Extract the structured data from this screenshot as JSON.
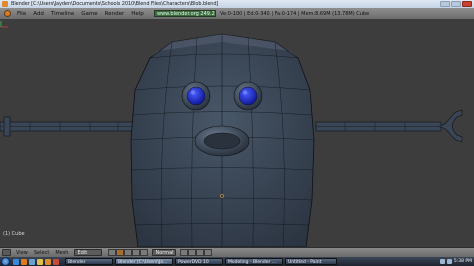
{
  "window": {
    "title": "Blender [C:\\Users\\Jayden\\Documents\\Schools 2010\\Blend Files\\Characters\\Blob.blend]",
    "buttons": [
      "minimize",
      "maximize",
      "close"
    ]
  },
  "menubar": {
    "items": [
      "File",
      "Add",
      "Timeline",
      "Game",
      "Render",
      "Help"
    ],
    "url": "www.blender.org 249.2",
    "stats": "Ve:0-100 | Ed:0-340 | Fa:0-174 | Mem:8.69M (13.78M) Cube"
  },
  "viewport": {
    "object_label": "(1) Cube",
    "background": "#3d3d3d",
    "mesh_color": "#3b4858",
    "eye_color": "#1423d8",
    "wire_color": "#0e1116"
  },
  "header": {
    "menus": [
      "View",
      "Select",
      "Mesh"
    ],
    "mode": "Edit Mode",
    "pivot": "Normal"
  },
  "taskbar": {
    "quick_icons": [
      "ie-icon",
      "media-icon",
      "explorer-icon",
      "folder-icon",
      "blender-icon",
      "app-icon"
    ],
    "tasks": [
      {
        "label": "Blender",
        "active": false
      },
      {
        "label": "Blender [C:\\Users\\Ja...",
        "active": true
      },
      {
        "label": "PowerDVD 10",
        "active": false
      },
      {
        "label": "Modeling - Blender ...",
        "active": false
      },
      {
        "label": "Untitled - Paint",
        "active": false
      }
    ],
    "clock": "5:38 PM"
  }
}
